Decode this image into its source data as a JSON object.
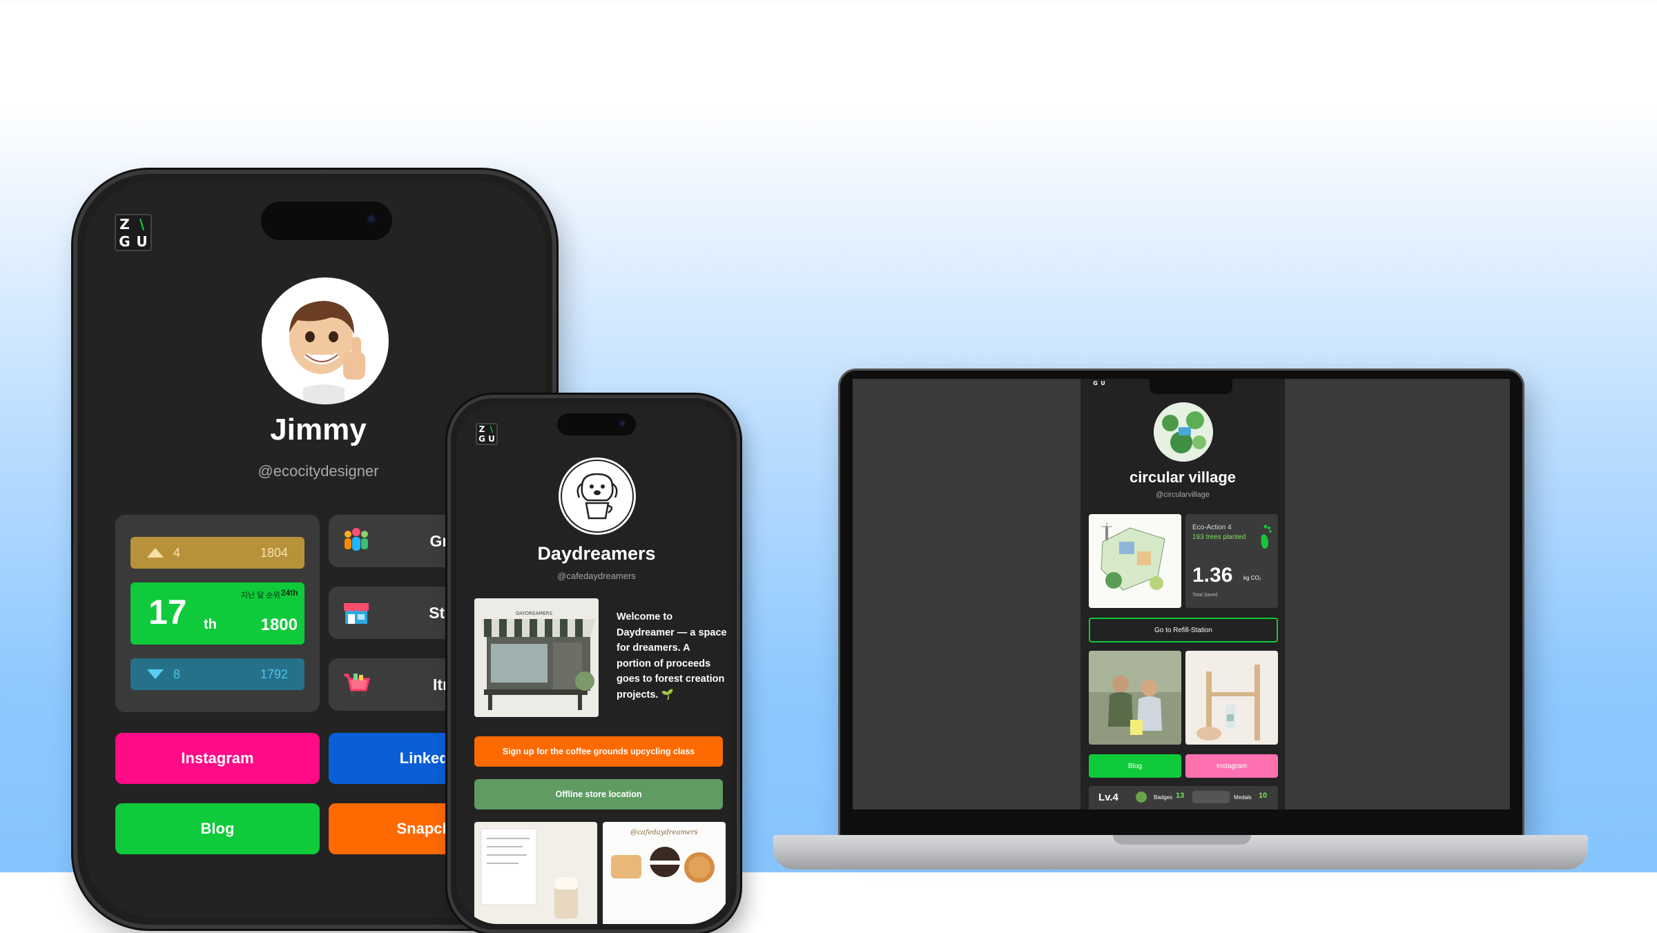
{
  "big_phone": {
    "logo": {
      "top_left": "Z",
      "top_right": "\\",
      "bottom_left": "G",
      "bottom_right": "U"
    },
    "name": "Jimmy",
    "handle": "@ecocitydesigner",
    "rank": {
      "up": {
        "rank": "4",
        "score": "1804"
      },
      "current": {
        "rank": "17",
        "suffix": "th",
        "note": "지난 달 순위",
        "note_value": "24th",
        "score": "1800"
      },
      "down": {
        "rank": "8",
        "score": "1792"
      }
    },
    "menu": [
      "Group",
      "Stores",
      "Itmes"
    ],
    "socials": [
      "Instagram",
      "Linkedin",
      "Blog",
      "Snapchat"
    ]
  },
  "small_phone": {
    "logo": {
      "top_left": "Z",
      "top_right": "\\",
      "bottom_left": "G",
      "bottom_right": "U"
    },
    "name": "Daydreamers",
    "handle": "@cafedaydreamers",
    "welcome": "Welcome to Daydreamer — a space for dreamers. A portion of proceeds goes to forest creation projects. 🌱",
    "buttons": {
      "upcycling": "Sign up for the coffee grounds upcycling class",
      "location": "Offline store location"
    },
    "shop_sign": "DAYDREAMERS",
    "gallery_caption": "@cafedaydreamers"
  },
  "laptop": {
    "logo": {
      "top_left": "Z",
      "top_right": "\\",
      "bottom_left": "G",
      "bottom_right": "U"
    },
    "name": "circular village",
    "handle": "@circularvillage",
    "eco": {
      "title": "Eco-Action 4",
      "subtitle": "193 trees planted",
      "value": "1.36",
      "unit": "kg CO₂",
      "caption": "Total Saved"
    },
    "refill_button": "Go to Refill-Station",
    "links": [
      "Blog",
      "Instagram"
    ],
    "stats": {
      "level": "Lv.4",
      "badges_label": "Badges",
      "badges": "13",
      "medals_label": "Medals",
      "medals": "10"
    }
  },
  "colors": {
    "green": "#0fca3a",
    "pink": "#ff0a87",
    "blue": "#0a5fd6",
    "orange": "#ff6a00",
    "gold": "#b8923a",
    "teal": "#26718a",
    "sage": "#5f9c62",
    "laptop_pink": "#ff70b0"
  }
}
